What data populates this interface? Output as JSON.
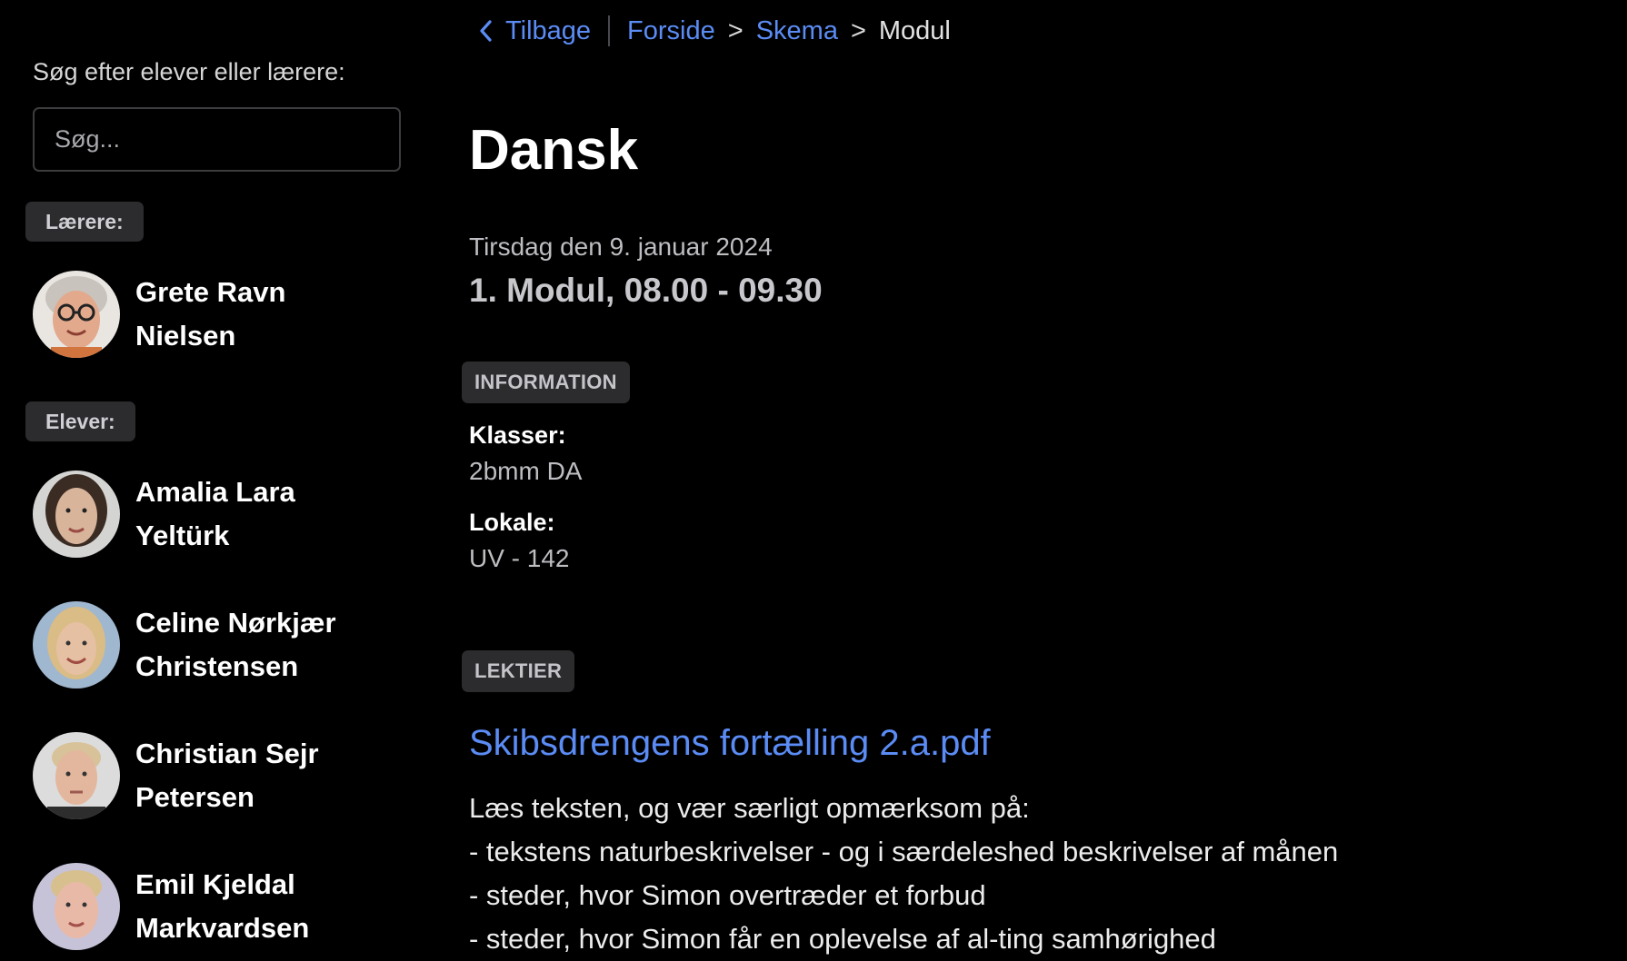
{
  "sidebar": {
    "search_label": "Søg efter elever eller lærere:",
    "search_placeholder": "Søg...",
    "teachers_label": "Lærere:",
    "students_label": "Elever:",
    "teachers": [
      {
        "first": "Grete Ravn",
        "last": "Nielsen"
      }
    ],
    "students": [
      {
        "first": "Amalia Lara",
        "last": "Yeltürk"
      },
      {
        "first": "Celine Nørkjær",
        "last": "Christensen"
      },
      {
        "first": "Christian Sejr",
        "last": "Petersen"
      },
      {
        "first": "Emil Kjeldal",
        "last": "Markvardsen"
      }
    ]
  },
  "breadcrumb": {
    "back": "Tilbage",
    "home": "Forside",
    "schedule": "Skema",
    "current": "Modul",
    "arrow": ">"
  },
  "lesson": {
    "title": "Dansk",
    "date": "Tirsdag den 9. januar 2024",
    "module": "1. Modul, 08.00 - 09.30"
  },
  "information": {
    "tag": "INFORMATION",
    "classes_label": "Klasser:",
    "classes_value": "2bmm DA",
    "room_label": "Lokale:",
    "room_value": "UV - 142"
  },
  "homework": {
    "tag": "LEKTIER",
    "file": "Skibsdrengens fortælling 2.a.pdf",
    "lines": [
      "Læs teksten, og vær særligt opmærksom på:",
      "- tekstens naturbeskrivelser - og i særdeleshed beskrivelser af månen",
      "- steder, hvor Simon overtræder et forbud",
      "- steder, hvor Simon får en oplevelse af al-ting samhørighed"
    ]
  },
  "colors": {
    "link": "#5b8cf5",
    "background": "#000000",
    "pill": "#2c2c2e"
  }
}
